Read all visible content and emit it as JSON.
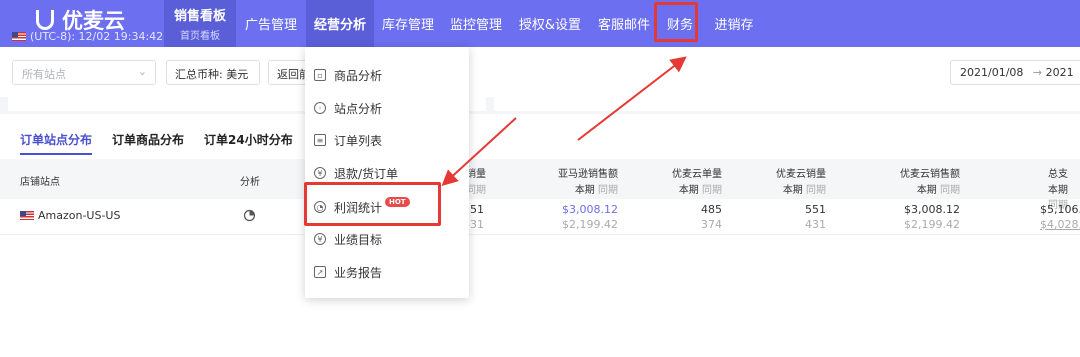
{
  "header": {
    "brand": "优麦云",
    "clock": "(UTC-8): 12/02 19:34:42",
    "nav": [
      {
        "label": "销售看板",
        "sub": "首页看板"
      },
      {
        "label": "广告管理"
      },
      {
        "label": "经营分析"
      },
      {
        "label": "库存管理"
      },
      {
        "label": "监控管理"
      },
      {
        "label": "授权&设置"
      },
      {
        "label": "客服邮件"
      },
      {
        "label": "财务"
      },
      {
        "label": "进销存"
      }
    ]
  },
  "filters": {
    "site_placeholder": "所有站点",
    "currency_label": "汇总币种: 美元",
    "back_label": "返回前",
    "date_range": "2021/01/08",
    "date_arrow": "→",
    "date_end": "2021"
  },
  "tabs": [
    "订单站点分布",
    "订单商品分布",
    "订单24小时分布"
  ],
  "table": {
    "headers": {
      "store_site": "店铺站点",
      "analysis": "分析",
      "col1": "销量",
      "col2": "亚马逊销售额",
      "col3": "优麦云单量",
      "col4": "优麦云销量",
      "col5": "优麦云销售额",
      "col6": "总支"
    },
    "sub_current": "本期",
    "sub_previous": "同期",
    "rows": [
      {
        "site": "Amazon-US-US",
        "col1_cur": "551",
        "col1_prev": "431",
        "col2_cur": "$3,008.12",
        "col2_prev": "$2,199.42",
        "col3_cur": "485",
        "col3_prev": "374",
        "col4_cur": "551",
        "col4_prev": "431",
        "col5_cur": "$3,008.12",
        "col5_prev": "$2,199.42",
        "col6_cur": "$5,106.",
        "col6_prev": "$4,028."
      }
    ]
  },
  "menu": {
    "items": [
      {
        "label": "商品分析",
        "icon": "package-icon"
      },
      {
        "label": "站点分析",
        "icon": "globe-icon"
      },
      {
        "label": "订单列表",
        "icon": "list-icon"
      },
      {
        "label": "退款/货订单",
        "icon": "refund-icon"
      },
      {
        "label": "利润统计",
        "icon": "pie-chart-icon"
      },
      {
        "label": "业绩目标",
        "icon": "target-yen-icon"
      },
      {
        "label": "业务报告",
        "icon": "report-icon"
      }
    ],
    "hot_badge": "HOT"
  },
  "colors": {
    "nav_bg": "#6b6ff0",
    "accent": "#4a50d0",
    "annotation": "#e53935",
    "hot": "#e84b4b"
  }
}
